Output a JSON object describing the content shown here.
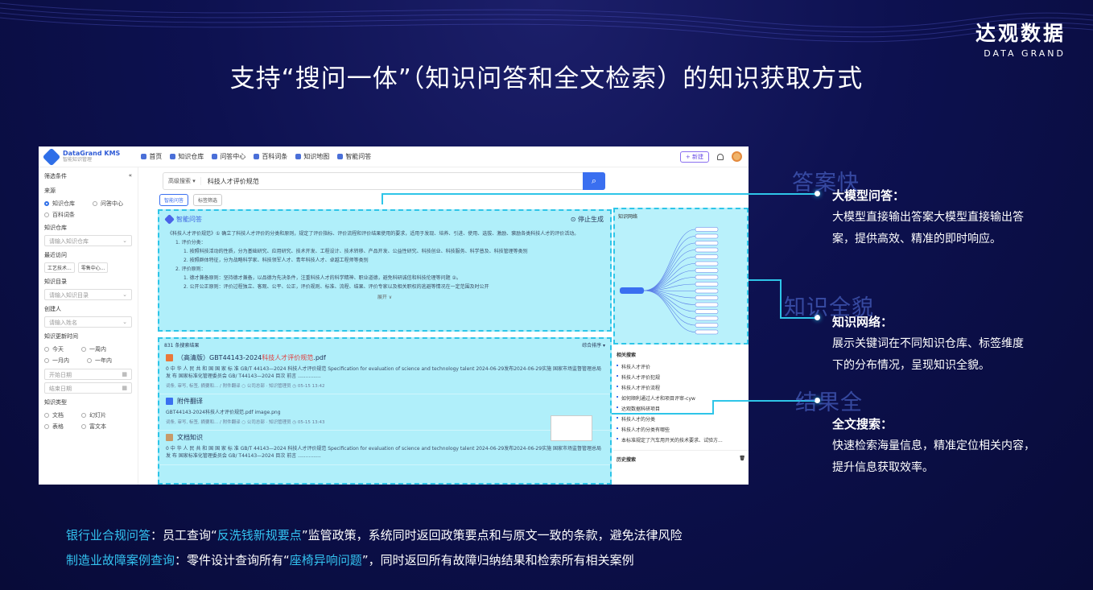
{
  "brand": {
    "zh": "达观数据",
    "en": "DATA GRAND"
  },
  "title": "支持“搜问一体”（知识问答和全文检索）的知识获取方式",
  "app": {
    "logo": "DataGrand KMS",
    "logo_sub": "智能知识管理",
    "nav": [
      "首页",
      "知识仓库",
      "问答中心",
      "百科词条",
      "知识地图",
      "智能问答"
    ],
    "new_btn": "+ 新建",
    "sidebar": {
      "header": "筛选条件",
      "collapse": "«",
      "source_label": "来源",
      "sources": [
        "知识仓库",
        "问答中心",
        "百科词条"
      ],
      "repo_label": "知识仓库",
      "repo_ph": "请输入知识仓库",
      "recent_label": "最近访问",
      "recent": [
        "工艺技术...",
        "零售中心..."
      ],
      "dir_label": "知识目录",
      "dir_ph": "请输入知识目录",
      "creator_label": "创建人",
      "creator_ph": "请输入姓名",
      "time_label": "知识更新时间",
      "times": [
        "今天",
        "一周内",
        "一月内",
        "一年内"
      ],
      "start_ph": "开始日期",
      "end_ph": "结束日期",
      "type_label": "知识类型",
      "types": [
        "文档",
        "幻灯片",
        "表格",
        "富文本"
      ]
    },
    "search": {
      "mode": "高级搜索 ▾",
      "query": "科技人才评价规范"
    },
    "tabs": [
      "智能问答",
      "标签筛选"
    ],
    "qa": {
      "title": "智能问答",
      "stop": "停止生成",
      "intro": "《科技人才评价规范》① 确立了科技人才评价的分类和原则，规定了评价指标、评价流程和评价结果使用的要求，适用于发现、培养、引进、使用、选拔、激励、褒励各类科技人才的评价活动。",
      "p1": "1. 评价分类：",
      "p1a": "1. 按照科技活动的性质，分为基础研究、应用研究、技术开发、工程设计、技术转移、产品开发、公益性研究、科技创业、科技服务、科学普及、科技管理等类别",
      "p1b": "2. 按照群体特征，分为战略科学家、科技领军人才、青年科技人才、卓越工程师等类别",
      "p2": "2. 评价原则：",
      "p2a": "1. 德才兼备原则：坚持德才兼备，以品德为先决条件，注重科技人才的科学精神、职业道德，避免科研诚信和科技伦理等问题 ②。",
      "p2b": "2. 公开公正原则：评价过程独立、客观、公平、公正，评价规则、标准、流程、结果、评价专家以及相关职权的逃避等情况在一定范围及时公开",
      "expand": "展开 ∨"
    },
    "results": {
      "count": "831 条搜索结果",
      "sort": "综合排序 ▾",
      "items": [
        {
          "title_pre": "（高清版）GBT44143-2024",
          "title_hl": "科技人才评价规范",
          "title_post": ".pdf",
          "desc": "0 中 华 人 民 共 和 国 国 家 标 准 GB/T 44143—2024 科技人才评价规范 Specification for evaluation of science and technology talent 2024-06-29发布2024-06-29实施 国家市场监督管理总局 发 布 国家标准化管理委员会 GB/ T44143—2024 目次 前言 ...............",
          "meta": "词条, 审写, 标签, 摘要和... / 附件翻译   ○ 公司总部 · 知识管理员   ◷ 05-15 13:42"
        },
        {
          "title_pre": "附件翻译",
          "title_hl": "",
          "title_post": "",
          "desc": "GBT44143-2024科技人才评价规范.pdf image.png",
          "meta": "词条, 审写, 标签, 摘要和... / 附件翻译   ○ 公司总部 · 知识管理员   ◷ 05-15 13:43"
        },
        {
          "title_pre": "文档知识",
          "title_hl": "",
          "title_post": "",
          "desc": "0 中 华 人 民 共 和 国 国 家 标 准 GB/T 44143—2024 科技人才评价规范 Specification for evaluation of science and technology talent 2024-06-29发布2024-06-29实施 国家市场监督管理总局 发 布 国家标准化管理委员会 GB/ T44143—2024 目次 前言 ...............",
          "meta": ""
        }
      ]
    },
    "graph": {
      "title": "知识网络",
      "center": "科技人才评价规范"
    },
    "related": {
      "title": "相关搜索",
      "items": [
        "科技人才评价",
        "科技人才评价犯规",
        "科技人才评价流程",
        "如何顺利通过人才和项目评审-cyw",
        "达观数据科研项目",
        "科技人才的分类",
        "科技人才的分类有哪些",
        "本标准规定了汽车用开关的技术要求、试验方..."
      ],
      "history": "历史搜索"
    }
  },
  "features": [
    {
      "ghost": "答案快",
      "title": "大模型问答：",
      "desc1": "大模型直接输出答案大模型直接输出答",
      "desc2": "案，提供高效、精准的即时响应。"
    },
    {
      "ghost": "知识全貌",
      "title": "知识网络：",
      "desc1": "展示关键词在不同知识仓库、标签维度",
      "desc2": "下的分布情况，呈现知识全貌。"
    },
    {
      "ghost": "结果全",
      "title": "全文搜索：",
      "desc1": "快速检索海量信息，精准定位相关内容，",
      "desc2": "提升信息获取效率。"
    }
  ],
  "footer": [
    {
      "k": "银行业合规问答",
      "a": "：员工查询“",
      "h": "反洗钱新规要点",
      "b": "”监管政策，系统同时返回政策要点和与原文一致的条款，避免法律风险"
    },
    {
      "k": "制造业故障案例查询",
      "a": "：零件设计查询所有“",
      "h": "座椅异响问题",
      "b": "”，同时返回所有故障归纳结果和检索所有相关案例"
    }
  ],
  "colors": {
    "accent": "#33c2f0",
    "highlight": "#7fe5f7",
    "bg": "#0a0e3f"
  }
}
